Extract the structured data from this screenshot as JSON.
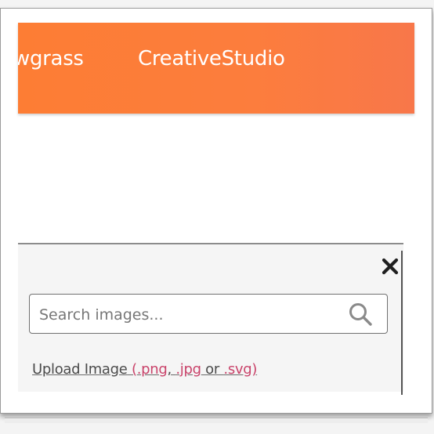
{
  "header": {
    "nav_items": [
      {
        "label": "wgrass"
      },
      {
        "label": "CreativeStudio"
      }
    ],
    "background_color": "#fc7d3a",
    "text_color": "#ffffff"
  },
  "image_panel": {
    "close_icon": "close-icon",
    "search": {
      "placeholder": "Search images...",
      "value": "",
      "icon": "search-icon"
    },
    "upload": {
      "label": "Upload Image",
      "paren_open": "(",
      "ext_png": ".png",
      "sep1": ", ",
      "ext_jpg": ".jpg",
      "sep2": " or ",
      "ext_svg": ".svg",
      "paren_close": ")"
    },
    "link_accent_color": "#c9436a"
  }
}
